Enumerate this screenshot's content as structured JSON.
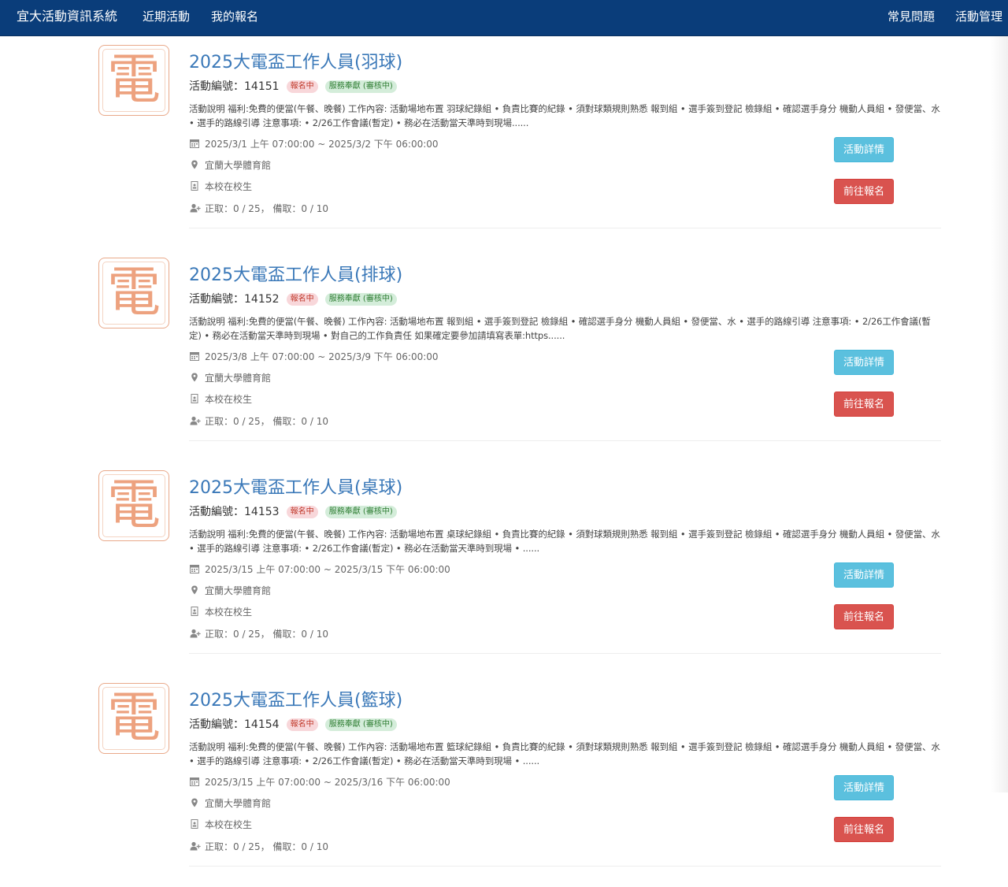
{
  "nav": {
    "brand": "宜大活動資訊系統",
    "recent": "近期活動",
    "mine": "我的報名",
    "faq": "常見問題",
    "admin": "活動管理"
  },
  "labels": {
    "activity_id": "活動編號：",
    "detail_button": "活動詳情",
    "register_button": "前往報名",
    "thumb_char": "電"
  },
  "colors": {
    "navbar": "#0a3d7a",
    "title_link": "#3a78b8",
    "detail_button": "#5bc0de",
    "register_button": "#d9534f"
  },
  "icons": {
    "date": "calendar-icon",
    "location": "map-marker-icon",
    "audience": "id-badge-icon",
    "quota": "user-add-icon"
  },
  "activities": [
    {
      "title": "2025大電盃工作人員(羽球)",
      "id": "14151",
      "status_badge": "報名中",
      "type_badge": "服務奉獻 (審核中)",
      "description": "活動說明 福利:免費的便當(午餐、晚餐) 工作內容: 活動場地布置 羽球紀錄組 • 負責比賽的紀錄 • 須對球類規則熟悉 報到組 • 選手簽到登記 檢錄組 • 確認選手身分 機動人員組 • 發便當、水 • 選手的路線引導 注意事項: • 2/26工作會議(暫定) • 務必在活動當天準時到現場......",
      "date": "2025/3/1 上午 07:00:00 ~ 2025/3/2 下午 06:00:00",
      "location": "宜蘭大學體育館",
      "audience": "本校在校生",
      "quota": "正取：0 / 25， 備取：0 / 10"
    },
    {
      "title": "2025大電盃工作人員(排球)",
      "id": "14152",
      "status_badge": "報名中",
      "type_badge": "服務奉獻 (審核中)",
      "description": "活動說明 福利:免費的便當(午餐、晚餐) 工作內容: 活動場地布置 報到組 • 選手簽到登記 檢錄組 • 確認選手身分 機動人員組 • 發便當、水 • 選手的路線引導 注意事項: • 2/26工作會議(暫定) • 務必在活動當天準時到現場 • 對自己的工作負責任 如果確定要參加請填寫表單:https......",
      "date": "2025/3/8 上午 07:00:00 ~ 2025/3/9 下午 06:00:00",
      "location": "宜蘭大學體育館",
      "audience": "本校在校生",
      "quota": "正取：0 / 25， 備取：0 / 10"
    },
    {
      "title": "2025大電盃工作人員(桌球)",
      "id": "14153",
      "status_badge": "報名中",
      "type_badge": "服務奉獻 (審核中)",
      "description": "活動說明 福利:免費的便當(午餐、晚餐) 工作內容: 活動場地布置 桌球紀錄組 • 負責比賽的紀錄 • 須對球類規則熟悉 報到組 • 選手簽到登記 檢錄組 • 確認選手身分 機動人員組 • 發便當、水 • 選手的路線引導 注意事項: • 2/26工作會議(暫定) • 務必在活動當天準時到現場 • ......",
      "date": "2025/3/15 上午 07:00:00 ~ 2025/3/15 下午 06:00:00",
      "location": "宜蘭大學體育館",
      "audience": "本校在校生",
      "quota": "正取：0 / 25， 備取：0 / 10"
    },
    {
      "title": "2025大電盃工作人員(籃球)",
      "id": "14154",
      "status_badge": "報名中",
      "type_badge": "服務奉獻 (審核中)",
      "description": "活動說明 福利:免費的便當(午餐、晚餐) 工作內容: 活動場地布置 籃球紀錄組 • 負責比賽的紀錄 • 須對球類規則熟悉 報到組 • 選手簽到登記 檢錄組 • 確認選手身分 機動人員組 • 發便當、水 • 選手的路線引導 注意事項: • 2/26工作會議(暫定) • 務必在活動當天準時到現場 • ......",
      "date": "2025/3/15 上午 07:00:00 ~ 2025/3/16 下午 06:00:00",
      "location": "宜蘭大學體育館",
      "audience": "本校在校生",
      "quota": "正取：0 / 25， 備取：0 / 10"
    }
  ]
}
